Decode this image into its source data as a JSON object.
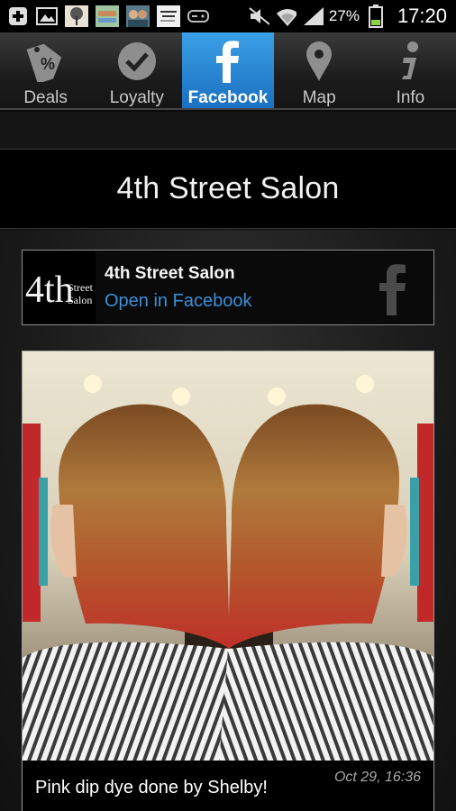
{
  "statusbar": {
    "battery": "27%",
    "time": "17:20"
  },
  "tabs": [
    {
      "label": "Deals",
      "icon": "percent-tag-icon"
    },
    {
      "label": "Loyalty",
      "icon": "check-badge-icon"
    },
    {
      "label": "Facebook",
      "icon": "facebook-icon",
      "active": true
    },
    {
      "label": "Map",
      "icon": "map-pin-icon"
    },
    {
      "label": "Info",
      "icon": "info-icon"
    }
  ],
  "page": {
    "title": "4th Street Salon"
  },
  "fb_card": {
    "logo_text_big": "4th",
    "logo_text_small1": "Street",
    "logo_text_small2": "Salon",
    "name": "4th Street Salon",
    "link": "Open in Facebook"
  },
  "post": {
    "caption": "Pink dip dye done by Shelby!",
    "date": "Oct 29, 16:36"
  },
  "colors": {
    "accent": "#2a88d8",
    "link": "#3a8fd8"
  }
}
